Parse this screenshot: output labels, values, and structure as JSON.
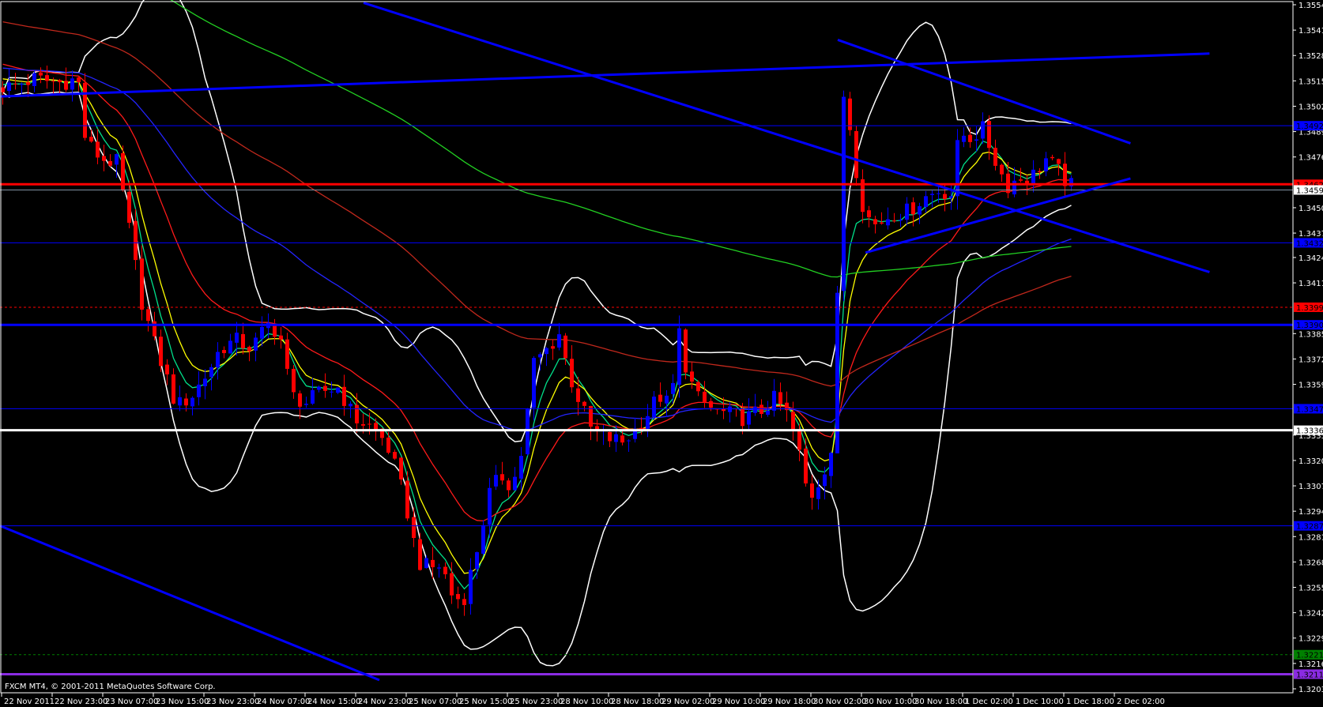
{
  "footer": "FXCM MT4, © 2001-2011 MetaQuotes Software Corp.",
  "chart_data": {
    "type": "candlestick",
    "title": "",
    "timeframe_note": "bar index in hours from chart start",
    "ylim": [
      1.32035,
      1.3554
    ],
    "colors": {
      "bull": "#0000ff",
      "bear": "#ff0000",
      "background": "#000000",
      "axis": "#ffffff"
    },
    "price_path": [
      [
        1.3,
        1.3512
      ],
      [
        5,
        1.3516
      ],
      [
        8.8,
        1.3514
      ],
      [
        11.9,
        1.3516
      ],
      [
        13.1,
        1.3484
      ],
      [
        15.6,
        1.3475
      ],
      [
        18.1,
        1.3473
      ],
      [
        20,
        1.3439
      ],
      [
        21.9,
        1.3403
      ],
      [
        23.8,
        1.3382
      ],
      [
        25.6,
        1.3366
      ],
      [
        27.5,
        1.3348
      ],
      [
        30,
        1.3354
      ],
      [
        32.5,
        1.3366
      ],
      [
        34.4,
        1.3378
      ],
      [
        36.9,
        1.3382
      ],
      [
        39.4,
        1.3378
      ],
      [
        41.9,
        1.339
      ],
      [
        43.8,
        1.3386
      ],
      [
        45.6,
        1.3354
      ],
      [
        48.1,
        1.335
      ],
      [
        50.6,
        1.3356
      ],
      [
        53.1,
        1.3358
      ],
      [
        55.6,
        1.3342
      ],
      [
        58.1,
        1.3338
      ],
      [
        60.6,
        1.333
      ],
      [
        62.5,
        1.3313
      ],
      [
        64.4,
        1.3289
      ],
      [
        65.6,
        1.3269
      ],
      [
        67.5,
        1.3265
      ],
      [
        69.4,
        1.3267
      ],
      [
        71.3,
        1.3249
      ],
      [
        73.1,
        1.3251
      ],
      [
        75,
        1.3275
      ],
      [
        76.9,
        1.3303
      ],
      [
        78.8,
        1.3313
      ],
      [
        80.6,
        1.3307
      ],
      [
        82.5,
        1.333
      ],
      [
        83.8,
        1.337
      ],
      [
        86.3,
        1.3378
      ],
      [
        88.1,
        1.3386
      ],
      [
        89.4,
        1.3366
      ],
      [
        91.3,
        1.335
      ],
      [
        93.1,
        1.3336
      ],
      [
        95.6,
        1.3332
      ],
      [
        98.1,
        1.333
      ],
      [
        100,
        1.3336
      ],
      [
        101.9,
        1.3344
      ],
      [
        103.8,
        1.3354
      ],
      [
        105.6,
        1.3348
      ],
      [
        107.3,
        1.3394
      ],
      [
        108.1,
        1.3366
      ],
      [
        110,
        1.3352
      ],
      [
        112.5,
        1.3346
      ],
      [
        115,
        1.3344
      ],
      [
        117.5,
        1.3342
      ],
      [
        120,
        1.3346
      ],
      [
        121.9,
        1.3352
      ],
      [
        123.8,
        1.3346
      ],
      [
        125.6,
        1.333
      ],
      [
        127.5,
        1.33
      ],
      [
        129.4,
        1.3312
      ],
      [
        131.3,
        1.3328
      ],
      [
        132.3,
        1.3435
      ],
      [
        133.1,
        1.3518
      ],
      [
        134.4,
        1.348
      ],
      [
        136.3,
        1.3447
      ],
      [
        138.1,
        1.3441
      ],
      [
        140.6,
        1.3447
      ],
      [
        143.1,
        1.3448
      ],
      [
        145.6,
        1.3455
      ],
      [
        148.1,
        1.3459
      ],
      [
        150,
        1.3457
      ],
      [
        151.3,
        1.3488
      ],
      [
        153.1,
        1.3486
      ],
      [
        155,
        1.349
      ],
      [
        156.9,
        1.3475
      ],
      [
        158.8,
        1.3461
      ],
      [
        160.6,
        1.3465
      ],
      [
        162.5,
        1.3465
      ],
      [
        165,
        1.3475
      ],
      [
        166.9,
        1.3469
      ],
      [
        168.8,
        1.3461
      ]
    ],
    "indicators": [
      {
        "name": "EMA 5",
        "period": 5,
        "color": "#00e08a",
        "init": 1.3515
      },
      {
        "name": "EMA 8",
        "period": 8,
        "color": "#ffff00",
        "init": 1.3518
      },
      {
        "name": "EMA 21",
        "period": 21,
        "color": "#ff1a1a",
        "init": 1.3525
      },
      {
        "name": "EMA 55",
        "period": 55,
        "color": "#2424ff",
        "init": 1.3522
      },
      {
        "name": "EMA 100",
        "period": 100,
        "color": "#c0281c",
        "init": 1.3546
      },
      {
        "name": "EMA 200",
        "period": 200,
        "color": "#22d022",
        "init": 1.3585
      }
    ],
    "bollinger": {
      "period": 20,
      "deviation": 2,
      "color": "#ffffff"
    },
    "horizontal_levels": [
      {
        "price": 1.3492,
        "label": "1.34920",
        "color": "#0000ff",
        "style": "thin"
      },
      {
        "price": 1.3462,
        "label": "1.34620",
        "color": "#ff0000",
        "style": "thick"
      },
      {
        "price": 1.34591,
        "label": "1.34591",
        "color": "#8090a0",
        "style": "bid"
      },
      {
        "price": 1.3432,
        "label": "1.34320",
        "color": "#0000ff",
        "style": "thin"
      },
      {
        "price": 1.3399,
        "label": "1.33990",
        "color": "#ff0000",
        "style": "dashed"
      },
      {
        "price": 1.339,
        "label": "1.33900",
        "color": "#0000ff",
        "style": "thick"
      },
      {
        "price": 1.3347,
        "label": "1.33470",
        "color": "#0000ff",
        "style": "thin"
      },
      {
        "price": 1.3336,
        "label": "1.33360",
        "color": "#ffffff",
        "style": "thick"
      },
      {
        "price": 1.3287,
        "label": "1.32870",
        "color": "#0000ff",
        "style": "thin"
      },
      {
        "price": 1.3221,
        "label": "1.32210",
        "color": "#008000",
        "style": "dashed"
      },
      {
        "price": 1.3211,
        "label": "1.32110",
        "color": "#8a2be2",
        "style": "thick"
      }
    ],
    "trendlines": [
      {
        "from": [
          0,
          1.3507
        ],
        "to": [
          191.3,
          1.3529
        ]
      },
      {
        "from": [
          57.5,
          1.3555
        ],
        "to": [
          191.3,
          1.3417
        ]
      },
      {
        "from": [
          132.5,
          1.3536
        ],
        "to": [
          178.8,
          1.3483
        ]
      },
      {
        "from": [
          136.9,
          1.3427
        ],
        "to": [
          178.8,
          1.3465
        ]
      },
      {
        "from": [
          0,
          1.3287
        ],
        "to": [
          60,
          1.3208
        ]
      }
    ],
    "y_ticks": [
      "1.35540",
      "1.35410",
      "1.35280",
      "1.35150",
      "1.35020",
      "1.34890",
      "1.34760",
      "1.34500",
      "1.34370",
      "1.34245",
      "1.34115",
      "1.33855",
      "1.33725",
      "1.33595",
      "1.33335",
      "1.33205",
      "1.33075",
      "1.32945",
      "1.32815",
      "1.32685",
      "1.32555",
      "1.32425",
      "1.32295",
      "1.32165",
      "1.32035"
    ],
    "x_ticks": [
      "22 Nov 2011",
      "22 Nov 23:00",
      "23 Nov 07:00",
      "23 Nov 15:00",
      "23 Nov 23:00",
      "24 Nov 07:00",
      "24 Nov 15:00",
      "24 Nov 23:00",
      "25 Nov 07:00",
      "25 Nov 15:00",
      "25 Nov 23:00",
      "28 Nov 10:00",
      "28 Nov 18:00",
      "29 Nov 02:00",
      "29 Nov 10:00",
      "29 Nov 18:00",
      "30 Nov 02:00",
      "30 Nov 10:00",
      "30 Nov 18:00",
      "1 Dec 02:00",
      "1 Dec 10:00",
      "1 Dec 18:00",
      "2 Dec 02:00"
    ]
  }
}
